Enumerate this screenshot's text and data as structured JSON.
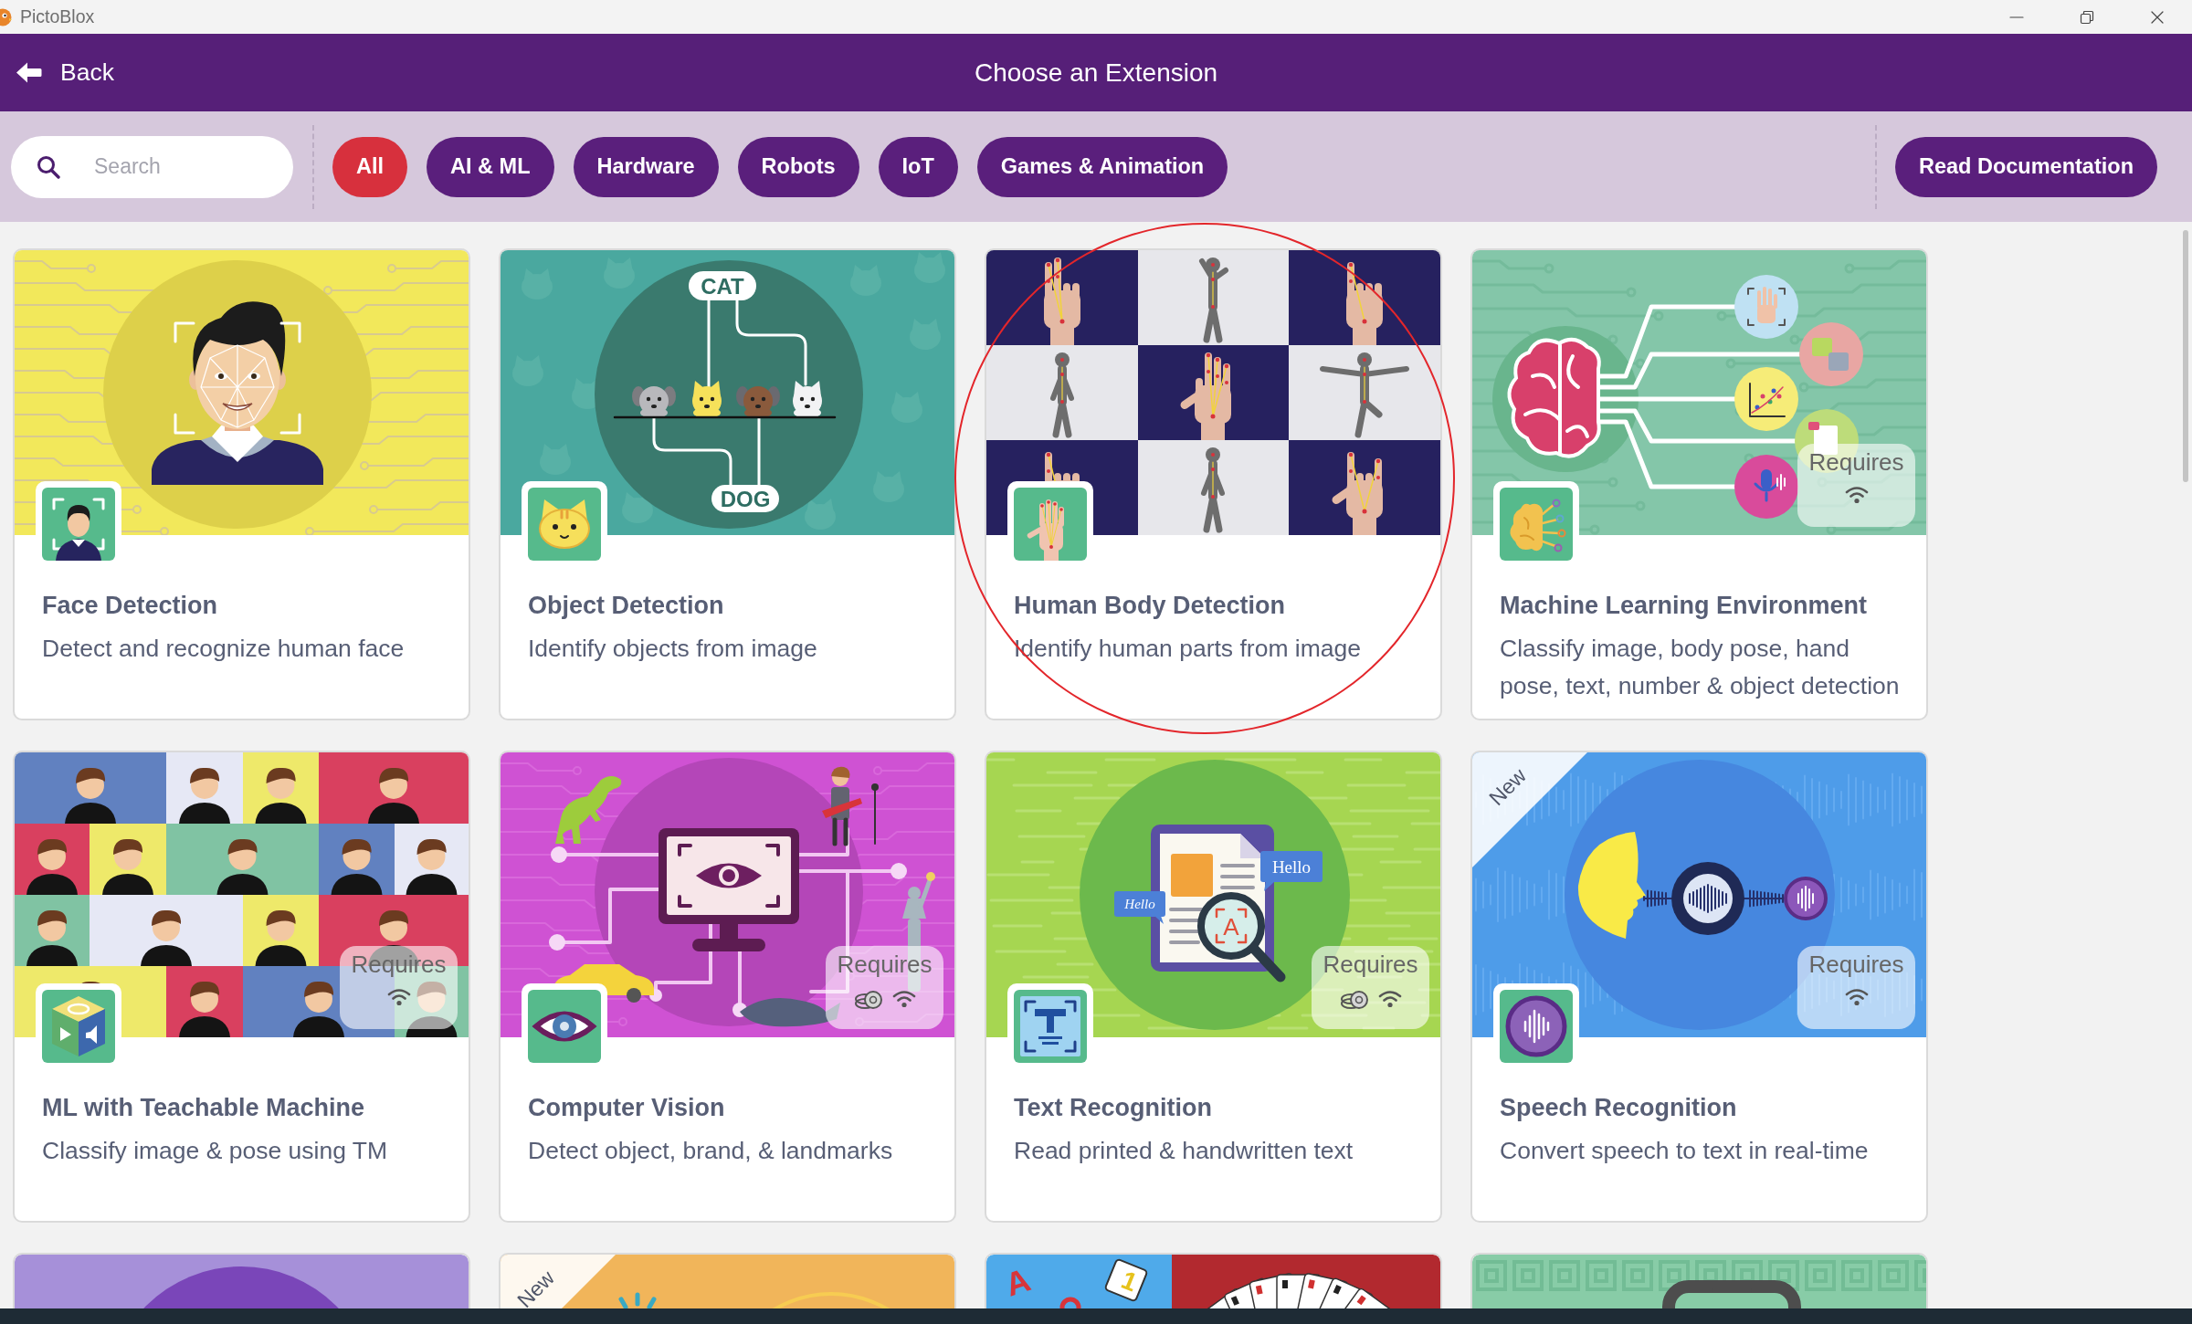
{
  "window": {
    "title": "PictoBlox"
  },
  "header": {
    "back_label": "Back",
    "title": "Choose an Extension"
  },
  "filter_bar": {
    "search": {
      "placeholder": "Search"
    },
    "filters": [
      {
        "label": "All",
        "selected": true
      },
      {
        "label": "AI & ML",
        "selected": false
      },
      {
        "label": "Hardware",
        "selected": false
      },
      {
        "label": "Robots",
        "selected": false
      },
      {
        "label": "IoT",
        "selected": false
      },
      {
        "label": "Games & Animation",
        "selected": false
      }
    ],
    "docs_button": "Read Documentation"
  },
  "cards": [
    {
      "kind": "face",
      "title": "Face Detection",
      "description": "Detect and recognize human face",
      "circled": false
    },
    {
      "kind": "objects",
      "title": "Object Detection",
      "description": "Identify objects from image",
      "art_labels": [
        "CAT",
        "DOG"
      ],
      "circled": false
    },
    {
      "kind": "body",
      "title": "Human Body Detection",
      "description": "Identify human parts from image",
      "circled": true
    },
    {
      "kind": "ml",
      "title": "Machine Learning Environment",
      "description": "Classify image, body pose, hand pose, text, number & object detection",
      "requires": {
        "label": "Requires",
        "items": [
          {
            "kind": "internet"
          }
        ]
      },
      "circled": false
    },
    {
      "kind": "teachable",
      "title": "ML with Teachable Machine",
      "description": "Classify image & pose using TM",
      "requires": {
        "label": "Requires",
        "items": [
          {
            "kind": "internet"
          }
        ]
      },
      "circled": false
    },
    {
      "kind": "vision",
      "title": "Computer Vision",
      "description": "Detect object, brand, & landmarks",
      "requires": {
        "label": "Requires",
        "items": [
          {
            "kind": "credits"
          },
          {
            "kind": "internet"
          }
        ]
      },
      "circled": false
    },
    {
      "kind": "text",
      "title": "Text Recognition",
      "description": "Read printed & handwritten text",
      "art_labels": [
        "Hello",
        "Hello",
        "A"
      ],
      "requires": {
        "label": "Requires",
        "items": [
          {
            "kind": "credits"
          },
          {
            "kind": "internet"
          }
        ]
      },
      "circled": false
    },
    {
      "kind": "speech",
      "title": "Speech Recognition",
      "description": "Convert speech to text in real-time",
      "ribbon": "New",
      "requires": {
        "label": "Requires",
        "items": [
          {
            "kind": "internet"
          }
        ]
      },
      "circled": false
    },
    {
      "kind": "circle",
      "circled": false
    },
    {
      "kind": "burst",
      "ribbon": "New",
      "circled": false
    },
    {
      "kind": "cards",
      "art_labels": [
        "A",
        "1"
      ],
      "circled": false
    },
    {
      "kind": "tablet",
      "circled": false
    }
  ]
}
